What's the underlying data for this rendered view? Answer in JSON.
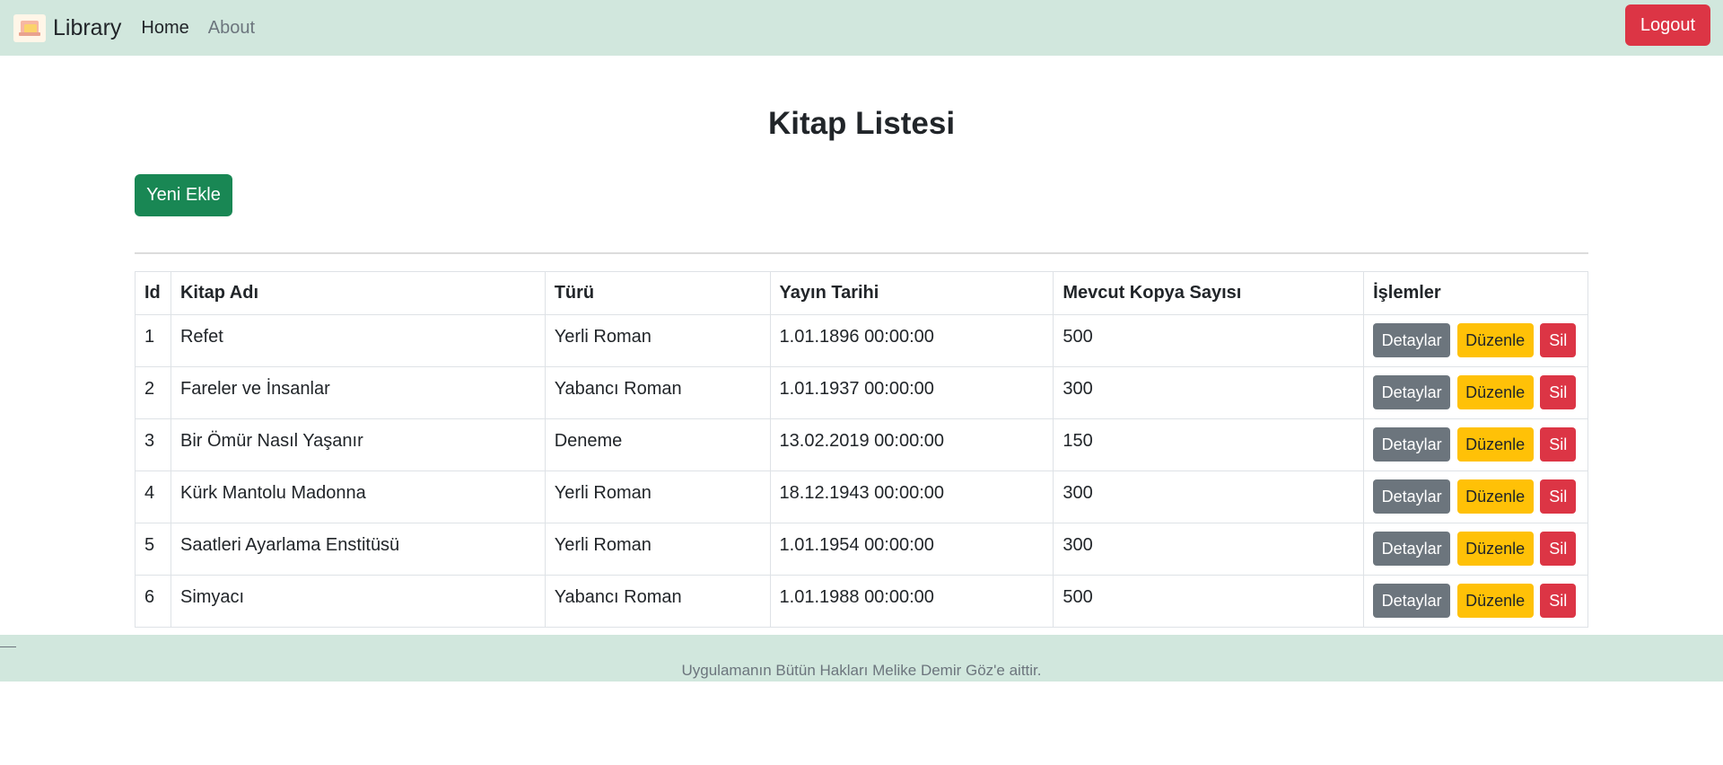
{
  "navbar": {
    "brand": "Library",
    "links": [
      "Home",
      "About"
    ],
    "logout": "Logout"
  },
  "page": {
    "title": "Kitap Listesi",
    "add_button": "Yeni Ekle"
  },
  "table": {
    "headers": [
      "Id",
      "Kitap Adı",
      "Türü",
      "Yayın Tarihi",
      "Mevcut Kopya Sayısı",
      "İşlemler"
    ],
    "rows": [
      [
        "1",
        "Refet",
        "Yerli Roman",
        "1.01.1896 00:00:00",
        "500"
      ],
      [
        "2",
        "Fareler ve İnsanlar",
        "Yabancı Roman",
        "1.01.1937 00:00:00",
        "300"
      ],
      [
        "3",
        "Bir Ömür Nasıl Yaşanır",
        "Deneme",
        "13.02.2019 00:00:00",
        "150"
      ],
      [
        "4",
        "Kürk Mantolu Madonna",
        "Yerli Roman",
        "18.12.1943 00:00:00",
        "300"
      ],
      [
        "5",
        "Saatleri Ayarlama Enstitüsü",
        "Yerli Roman",
        "1.01.1954 00:00:00",
        "300"
      ],
      [
        "6",
        "Simyacı",
        "Yabancı Roman",
        "1.01.1988 00:00:00",
        "500"
      ]
    ],
    "actions": {
      "details": "Detaylar",
      "edit": "Düzenle",
      "delete": "Sil"
    }
  },
  "footer": {
    "text": "Uygulamanın Bütün Hakları Melike Demir Göz'e aittir."
  },
  "colors": {
    "navbar_bg": "#d1e7dd",
    "danger": "#dc3545",
    "success": "#198754",
    "secondary": "#6c757d",
    "warning": "#ffc107"
  }
}
